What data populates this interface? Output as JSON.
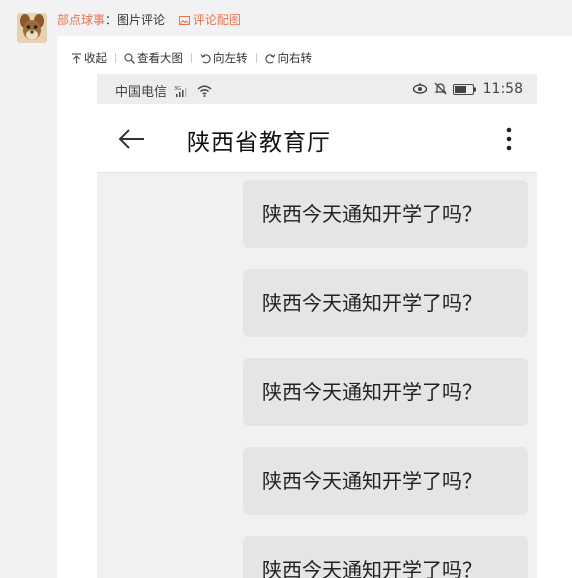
{
  "post": {
    "username": "部点球事",
    "colon": "：",
    "comment_type": "图片评论",
    "config_link": "评论配图"
  },
  "toolbar": {
    "collapse": "收起",
    "view_large": "查看大图",
    "rotate_left": "向左转",
    "rotate_right": "向右转"
  },
  "phone": {
    "status": {
      "carrier": "中国电信",
      "network": "3G",
      "time": "11:58"
    },
    "appbar": {
      "title": "陕西省教育厅"
    },
    "messages": [
      "陕西今天通知开学了吗？",
      "陕西今天通知开学了吗？",
      "陕西今天通知开学了吗？",
      "陕西今天通知开学了吗？",
      "陕西今天通知开学了吗？"
    ]
  }
}
